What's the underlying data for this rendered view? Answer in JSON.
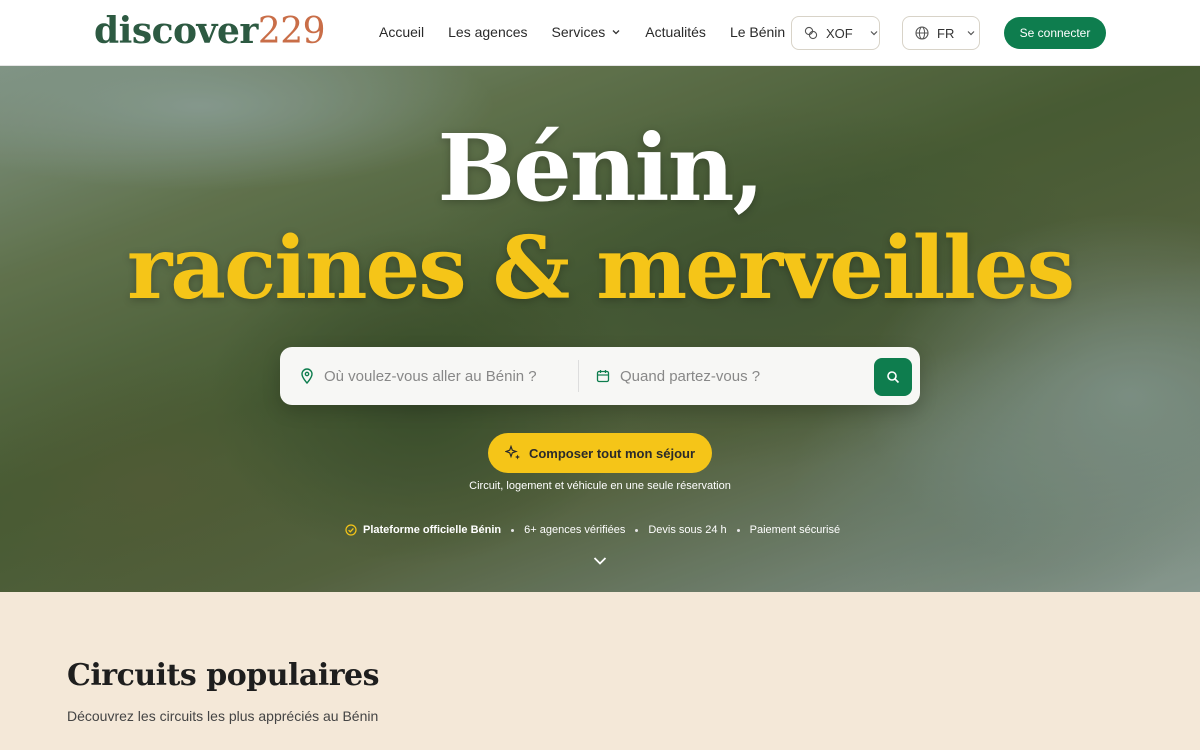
{
  "brand": {
    "part1": "discover",
    "part2": "229"
  },
  "nav": {
    "items": [
      {
        "label": "Accueil"
      },
      {
        "label": "Les agences"
      },
      {
        "label": "Services"
      },
      {
        "label": "Actualités"
      },
      {
        "label": "Le Bénin"
      }
    ]
  },
  "currency": {
    "value": "XOF",
    "icon": "currency-icon"
  },
  "language": {
    "value": "FR",
    "icon": "globe-icon"
  },
  "login_label": "Se connecter",
  "hero": {
    "title_line1": "Bénin,",
    "title_line2": "racines & merveilles",
    "search": {
      "where_placeholder": "Où voulez-vous aller au Bénin ?",
      "when_placeholder": "Quand partez-vous ?"
    },
    "compose_label": "Composer tout mon séjour",
    "compose_sub": "Circuit, logement et véhicule en une seule réservation",
    "badges": [
      "Plateforme officielle Bénin",
      "6+ agences vérifiées",
      "Devis sous 24 h",
      "Paiement sécurisé"
    ]
  },
  "section": {
    "title": "Circuits populaires",
    "subtitle": "Découvrez les circuits les plus appréciés au Bénin"
  },
  "colors": {
    "brand_green": "#0e7d4e",
    "logo_green": "#2d5a42",
    "logo_accent": "#c96e48",
    "hero_yellow": "#f5c518",
    "section_bg": "#f4e8d8"
  }
}
